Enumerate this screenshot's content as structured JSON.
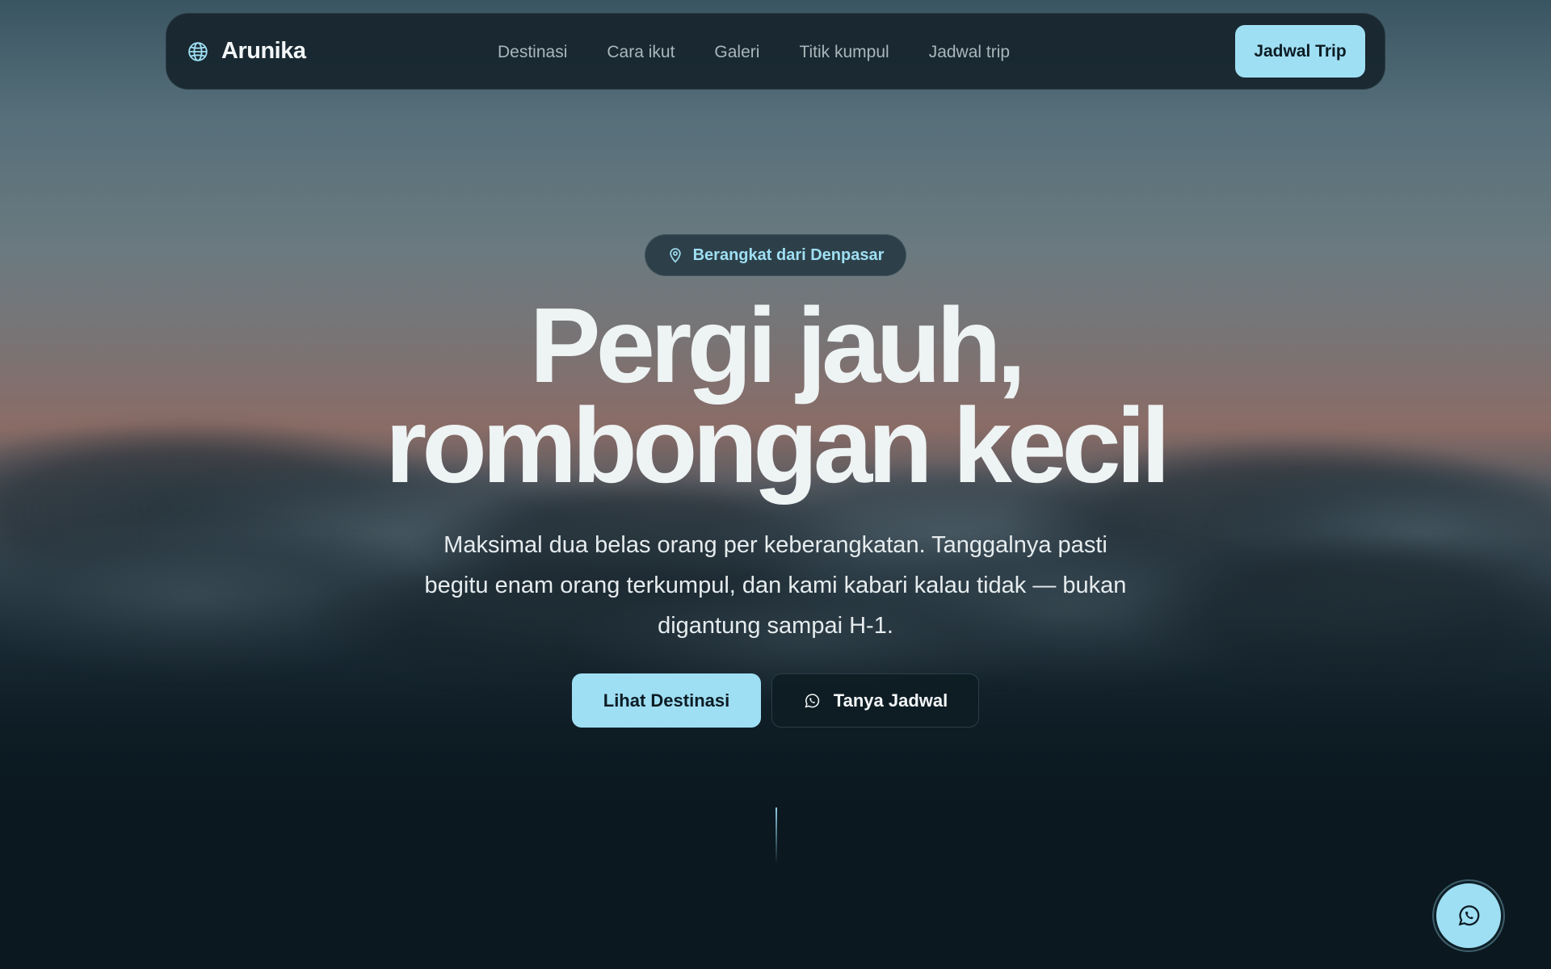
{
  "brand": {
    "name": "Arunika",
    "icon": "globe-icon"
  },
  "nav": {
    "links": [
      "Destinasi",
      "Cara ikut",
      "Galeri",
      "Titik kumpul",
      "Jadwal trip"
    ],
    "cta_label": "Jadwal Trip"
  },
  "hero": {
    "badge": {
      "icon": "map-pin-icon",
      "label": "Berangkat dari Denpasar"
    },
    "headline_line1": "Pergi jauh,",
    "headline_line2": "rombongan kecil",
    "subtext": "Maksimal dua belas orang per keberangkatan. Tanggalnya pasti begitu enam orang terkumpul, dan kami kabari kalau tidak — bukan digantung sampai H-1.",
    "primary_button": "Lihat Destinasi",
    "secondary_button": {
      "icon": "whatsapp-icon",
      "label": "Tanya Jadwal"
    }
  },
  "floating_button": {
    "icon": "whatsapp-icon"
  },
  "colors": {
    "accent": "#9fdff3",
    "background": "#0b1820",
    "nav_bg": "#16242c",
    "text_primary": "#eef3f4",
    "text_muted": "#aab6bb"
  }
}
